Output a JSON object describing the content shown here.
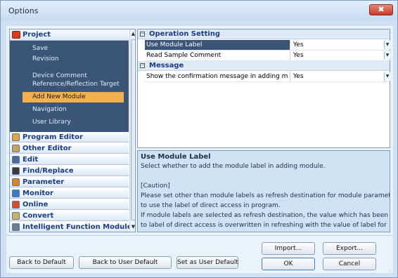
{
  "window": {
    "title": "Options",
    "close_glyph": "✖"
  },
  "nav": {
    "project_label": "Project",
    "sub_items": [
      {
        "label": "Save"
      },
      {
        "label": "Revision"
      },
      {
        "label": "Device Comment"
      },
      {
        "label": "Reference/Reflection Target"
      },
      {
        "label": "Add New Module",
        "selected": true
      },
      {
        "label": "Navigation"
      },
      {
        "label": "User Library"
      }
    ],
    "categories": [
      {
        "label": "Program Editor",
        "icon": "program-editor-icon",
        "color": "#e9a23b"
      },
      {
        "label": "Other Editor",
        "icon": "other-editor-icon",
        "color": "#c9a15a"
      },
      {
        "label": "Edit",
        "icon": "scissors-icon",
        "color": "#4d6a9a"
      },
      {
        "label": "Find/Replace",
        "icon": "binoculars-icon",
        "color": "#3a3a3a"
      },
      {
        "label": "Parameter",
        "icon": "parameter-icon",
        "color": "#d4862b"
      },
      {
        "label": "Monitor",
        "icon": "monitor-icon",
        "color": "#3b79c9"
      },
      {
        "label": "Online",
        "icon": "online-icon",
        "color": "#d84a2a"
      },
      {
        "label": "Convert",
        "icon": "convert-icon",
        "color": "#c7b36a"
      },
      {
        "label": "Intelligent Function Module",
        "icon": "intelligent-module-icon",
        "color": "#6c7d94"
      }
    ]
  },
  "grid": {
    "groups": [
      {
        "label": "Operation Setting",
        "toggle": "−",
        "rows": [
          {
            "name": "Use Module Label",
            "value": "Yes",
            "selected": true
          },
          {
            "name": "Read Sample Comment",
            "value": "Yes"
          }
        ]
      },
      {
        "label": "Message",
        "toggle": "−",
        "rows": [
          {
            "name": "Show the confirmation message in adding module",
            "value": "Yes"
          }
        ]
      }
    ]
  },
  "description": {
    "title": "Use Module Label",
    "lines": [
      "Select whether to add the module label in adding module.",
      "",
      "[Caution]",
      "Please set other than module labels as refresh destination for module parameter",
      "to use the label of direct access in program.",
      "If module labels are selected as refresh destination, the value which has been set",
      "to label of direct access is overwritten in refreshing with the value of label for"
    ]
  },
  "buttons": {
    "back_to_default": "Back to Default",
    "back_to_user_default": "Back to User Default",
    "set_as_user_default": "Set as User Default",
    "import": "Import...",
    "export": "Export...",
    "ok": "OK",
    "cancel": "Cancel"
  },
  "colors": {
    "accent": "#3a5578",
    "selected_item": "#f5b04c",
    "close": "#c8372a"
  }
}
